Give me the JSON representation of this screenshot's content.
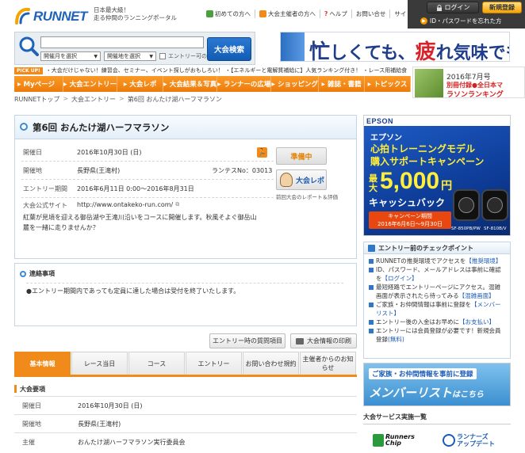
{
  "header": {
    "logo_text": "RUNNET",
    "tagline_1": "日本最大級！",
    "tagline_2": "走る仲間のランニングポータル",
    "nav": [
      "初めての方へ",
      "大会主催者の方へ",
      "ヘルプ",
      "お問い合せ",
      "サイトマップ"
    ],
    "help_mark": "?",
    "login_label": "ログイン",
    "register_label": "新規登録",
    "id_password_label": "ID・パスワードを忘れた方"
  },
  "search": {
    "keyword_placeholder": "",
    "month_select": "開催月を選択",
    "area_select": "開催地を選択",
    "entry_only_label": "エントリー可のみ",
    "button_label": "大会検索"
  },
  "top_banner": {
    "text_a": "忙",
    "text_b": "しくても、",
    "text_c": "疲",
    "text_d": "れ気味でも…"
  },
  "pickup": {
    "label": "PICK UP!",
    "text": "・大会だけじゃない！練習会、セミナー、イベント探しがおもしろい！ ・【エネルギーと電解質補給に】人気ランキング付き！ ・レース用補給食"
  },
  "main_nav": [
    "Myページ",
    "大会エントリー",
    "大会レポ",
    "大会結果＆写真",
    "ランナーの広場",
    "ショッピング",
    "雑誌・書籍",
    "トピックス"
  ],
  "july_banner": {
    "line1": "2016年7月号",
    "line2": "別冊付録●全日本マ",
    "line3": "ラソンランキング"
  },
  "breadcrumb": [
    "RUNNETトップ",
    "大会エントリー",
    "第6回 おんたけ湖ハーフマラソン"
  ],
  "breadcrumb_sep": ">",
  "race": {
    "title": "第6回 おんたけ湖ハーフマラソン",
    "date_label": "開催日",
    "date_value": "2016年10月30日 (日)",
    "place_label": "開催地",
    "place_value": "長野県(王滝村)",
    "lantes": "ランテスNo：03013",
    "entry_label": "エントリー期間",
    "entry_value": "2016年6月11日 0:00～2016年8月31日",
    "url_label": "大会公式サイト",
    "url_value": "http://www.ontakeko-run.com/",
    "description": "紅葉が見頃を迎える御岳湖や王滝川沿いをコースに開催します。秋風そよぐ御岳山麓を一緒に走りませんか？",
    "status_label": "準備中",
    "report_label": "大会レポ",
    "report_caption": "前回大会のレポート＆評価"
  },
  "notice": {
    "title": "連絡事項",
    "body": "●エントリー期間内であっても定員に達した場合は受付を終了いたします。"
  },
  "actions": {
    "qa_label": "エントリー時の質問項目",
    "print_label": "大会情報の印刷"
  },
  "tabs": [
    "基本情報",
    "レース当日",
    "コース",
    "エントリー",
    "お問い合わせ規約",
    "主催者からのお知らせ"
  ],
  "detail": {
    "section_title": "大会要項",
    "rows": [
      {
        "label": "開催日",
        "value": "2016年10月30日 (日)"
      },
      {
        "label": "開催地",
        "value": "長野県(王滝村)"
      },
      {
        "label": "主催",
        "value": "おんたけ湖ハーフマラソン実行委員会"
      }
    ]
  },
  "epson_ad": {
    "brand": "EPSON",
    "line1": "エプソン",
    "line2": "心拍トレーニングモデル",
    "line3": "購入サポートキャンペーン",
    "max": "最大",
    "price": "5,000",
    "yen": "円",
    "cashback": "キャッシュバック",
    "period_1": "キャンペーン期間",
    "period_2": "2016年6月6日～9月30日",
    "model_1": "SF-850PB/PW",
    "model_2": "SF-810B/V"
  },
  "checkpoints": {
    "title": "エントリー前のチェックポイント",
    "items": [
      {
        "text": "RUNNETの推奨環境でアクセスを",
        "link": "【推奨環境】"
      },
      {
        "text": "ID、パスワード、メールアドレスは事前に確認を",
        "link": "【ログイン】"
      },
      {
        "text": "最短経路でエントリーページにアクセス。混雑画面が表示されたら待ってみる",
        "link": "【混雑画面】"
      },
      {
        "text": "ご家族・お仲間情報は事前に登録を",
        "link": "【メンバーリスト】"
      },
      {
        "text": "エントリー後の入金はお早めに",
        "link": "【お支払い】"
      },
      {
        "text": "エントリーには会員登録が必要です！新規会員登録",
        "link": "(無料)"
      }
    ]
  },
  "member_ad": {
    "line1": "ご家族・お仲間情報を事前に登録",
    "line2": "メンバーリスト",
    "line3": "はこちら"
  },
  "services": {
    "title": "大会サービス実施一覧",
    "logo1_a": "Runners",
    "logo1_b": "Chip",
    "logo2_a": "ランナーズ",
    "logo2_b": "アップデート"
  },
  "colors": {
    "accent_orange": "#f08a1a",
    "brand_blue": "#1e63b8",
    "link_blue": "#1a5bb5"
  }
}
